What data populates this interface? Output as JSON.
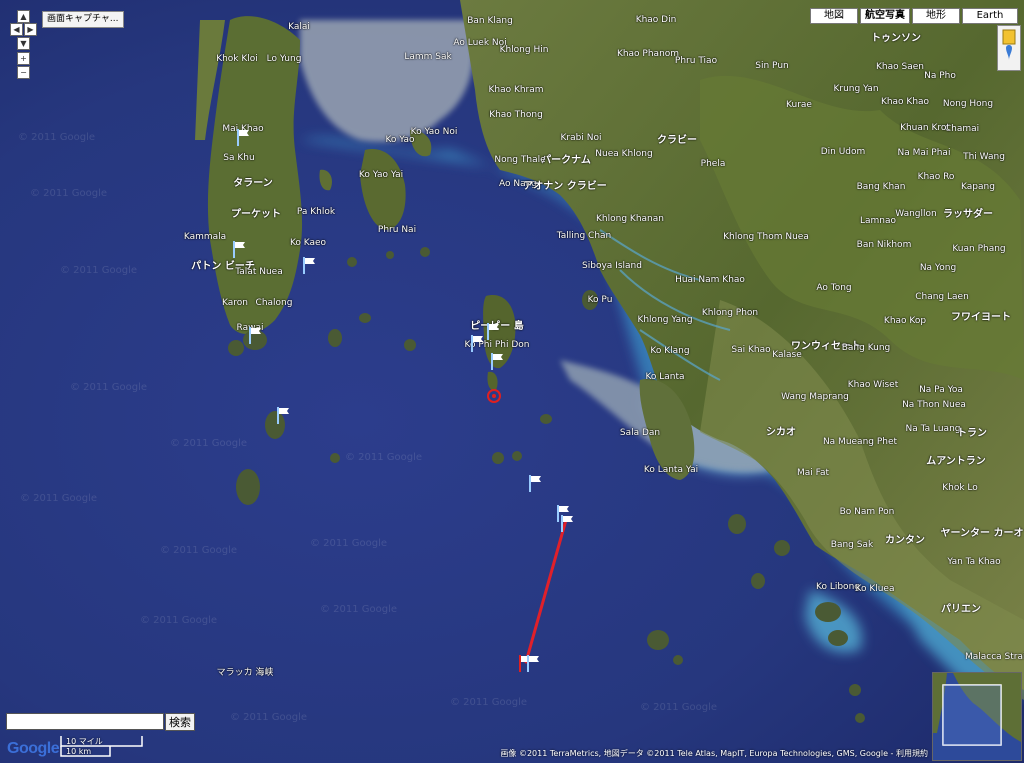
{
  "map_type_buttons": {
    "map": "地図",
    "satellite": "航空写真",
    "terrain": "地形",
    "earth": "Earth"
  },
  "capture_button": "画面キャプチャ...",
  "search": {
    "value": "",
    "button": "検索"
  },
  "scale": {
    "miles": "10 マイル",
    "km": "10 km"
  },
  "google_logo": "Google",
  "attribution": "画像 ©2011 TerraMetrics, 地図データ ©2011 Tele Atlas, MapIT, Europa Technologies, GMS, Google - 利用規約",
  "watermark": "© 2011 Google",
  "colors": {
    "sea": "#2a3a86",
    "deep_sea": "#1f2c70",
    "land": "#5b6b35",
    "shallow": "#56b5d9",
    "route": "#e0202a",
    "marker": "#e02020"
  },
  "map_labels": [
    "Kalai",
    "Khok Kloi",
    "Lo Yung",
    "Mai Khao",
    "Sa Khu",
    "タラーン",
    "プーケット",
    "Pa Khlok",
    "Kammala",
    "パトン ビーチ",
    "Talat Nuea",
    "Ko Kaeo",
    "Karon",
    "Chalong",
    "Rawai",
    "Lamm Sak",
    "Ban Klang",
    "Khao Din",
    "Ao Luek Noi",
    "Khlong Hin",
    "Khao Phanom",
    "Phru Tiao",
    "Sin Pun",
    "Khao Khram",
    "Khao Thong",
    "Ko Yao Noi",
    "Ko Yao",
    "Ko Yao Yai",
    "Phru Nai",
    "Krabi Noi",
    "クラビー",
    "パークナム",
    "Nong Thale",
    "Ao Nang",
    "アオナン クラビー",
    "Nuea Khlong",
    "Phela",
    "Khlong Khanan",
    "Talling Chan",
    "Siboya Island",
    "Ko Pu",
    "Khlong Thom Nuea",
    "Huai Nam Khao",
    "Khlong Phon",
    "Khlong Yang",
    "Sai Khao",
    "Kalase",
    "Ko Klang",
    "Ko Lanta",
    "Sala Dan",
    "Ko Lanta Yai",
    "ピーピー 島",
    "Ko Phi Phi Don",
    "Krung Yan",
    "トゥンソン",
    "Khao Saen",
    "Na Pho",
    "Kurae",
    "Khao Khao",
    "Nong Hong",
    "Chamai",
    "Khuan Krot",
    "Din Udom",
    "Na Mai Phai",
    "Thi Wang",
    "Bang Khan",
    "Ao Tong",
    "Khao Ro",
    "Kapang",
    "Lamnao",
    "Wangllon",
    "ラッサダー",
    "Ban Nikhom",
    "Khao Kop",
    "Na Yong",
    "Chang Laen",
    "Kuan Phang",
    "ワンウィセート",
    "Bang Kung",
    "フワイヨート",
    "Khao Wiset",
    "Na Pa Yoa",
    "Wang Maprang",
    "Na Thon Nuea",
    "Na Ta Luang",
    "トラン",
    "シカオ",
    "Na Mueang Phet",
    "ムアントラン",
    "Khok Lo",
    "Mai Fat",
    "Bo Nam Pon",
    "ヤーンター カーオ",
    "Bang Sak",
    "カンタン",
    "Yan Ta Khao",
    "Ko Libong",
    "Ko Kluea",
    "パリエン",
    "Malacca Strait",
    "マラッカ 海峡"
  ]
}
